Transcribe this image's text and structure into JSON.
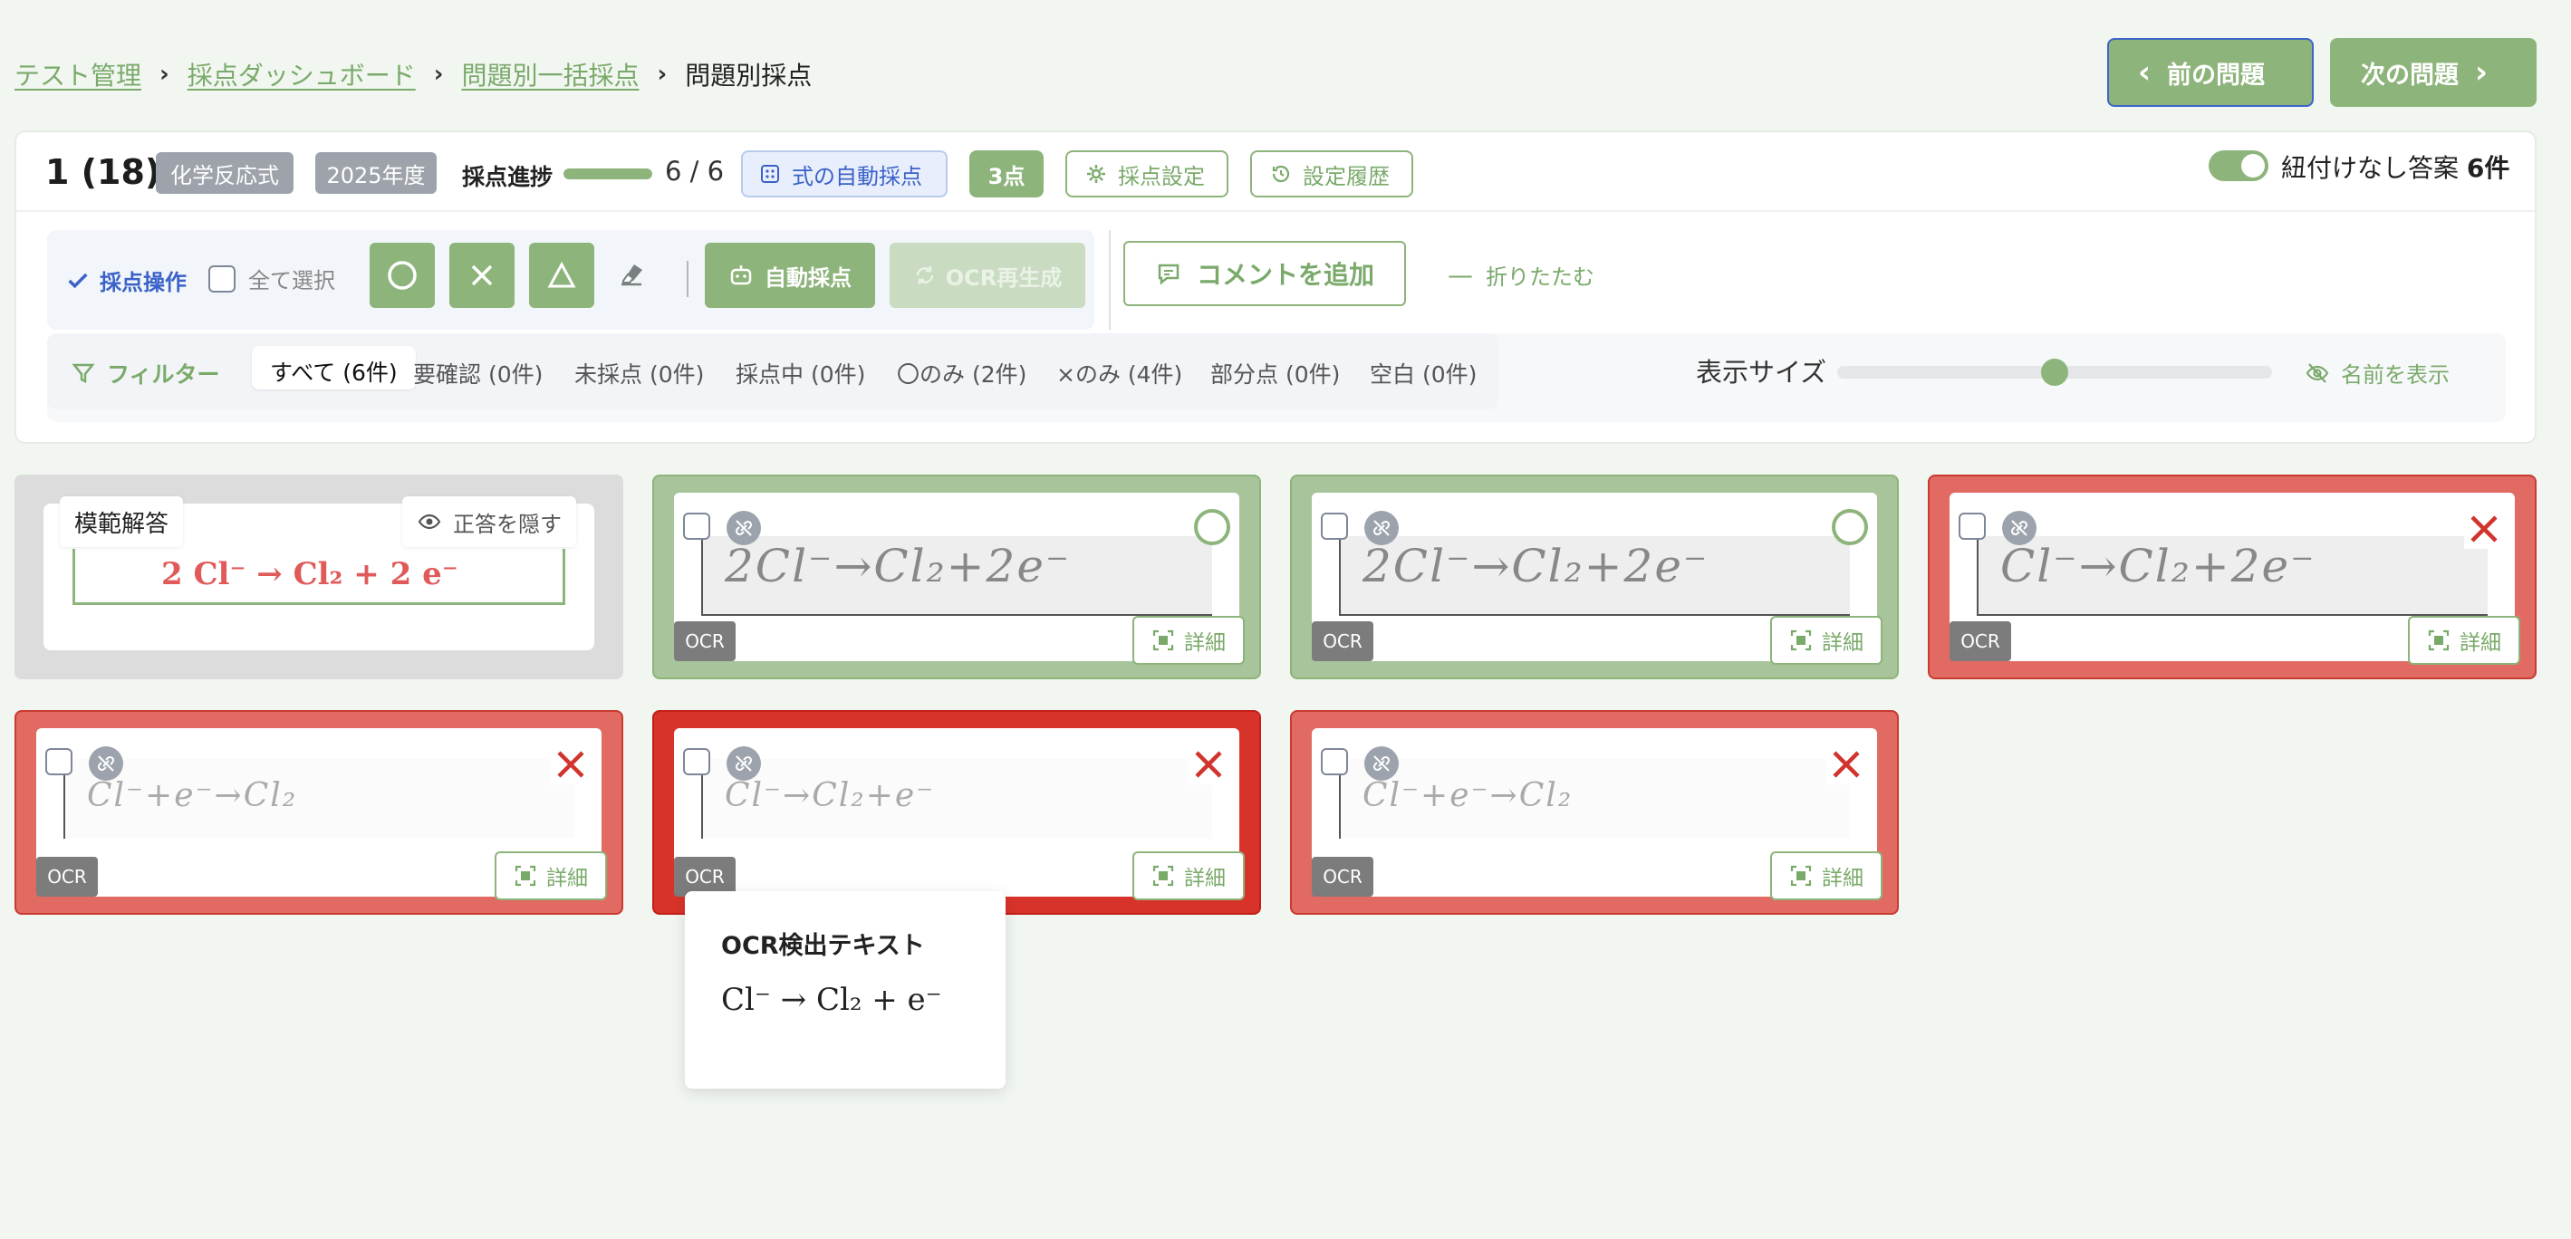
{
  "breadcrumb": {
    "items": [
      "テスト管理",
      "採点ダッシュボード",
      "問題別一括採点"
    ],
    "current": "問題別採点"
  },
  "nav": {
    "prev_label": "前の問題",
    "next_label": "次の問題"
  },
  "question": {
    "number": "1 (18)",
    "tags": [
      "化学反応式",
      "2025年度"
    ],
    "progress_label": "採点進捗",
    "progress_value": 1.0,
    "progress_text": "6 / 6",
    "auto_formula_label": "式の自動採点",
    "points": "3点",
    "settings_label": "採点設定",
    "history_label": "設定履歴",
    "unlinked_label": "紐付けなし答案",
    "unlinked_count": "6件",
    "unlinked_toggle_on": true
  },
  "operations": {
    "label": "採点操作",
    "select_all": "全て選択",
    "auto_grade": "自動採点",
    "ocr_regen": "OCR再生成",
    "add_comment": "コメントを追加",
    "collapse": "折りたたむ"
  },
  "filter": {
    "label": "フィルター",
    "tabs": [
      "すべて (6件)",
      "要確認 (0件)",
      "未採点 (0件)",
      "採点中 (0件)",
      "〇のみ (2件)",
      "×のみ (4件)",
      "部分点 (0件)",
      "空白 (0件)"
    ],
    "active_index": 0,
    "size_label": "表示サイズ",
    "size_value": 0.5,
    "show_name": "名前を表示"
  },
  "model_answer": {
    "label": "模範解答",
    "hide_label": "正答を隠す",
    "formula": "2 Cl⁻ → Cl₂ + 2 e⁻"
  },
  "answers": [
    {
      "handwriting": "2Cl⁻→Cl₂+2e⁻",
      "result": "correct"
    },
    {
      "handwriting": "2Cl⁻→Cl₂+2e⁻",
      "result": "correct"
    },
    {
      "handwriting": "Cl⁻→Cl₂+2e⁻",
      "result": "wrong"
    },
    {
      "handwriting": "Cl⁻+e⁻→Cl₂",
      "result": "wrong"
    },
    {
      "handwriting": "Cl⁻→Cl₂+e⁻",
      "result": "wrong"
    },
    {
      "handwriting": "Cl⁻+e⁻→Cl₂",
      "result": "wrong"
    }
  ],
  "card_labels": {
    "ocr": "OCR",
    "detail": "詳細"
  },
  "ocr_popup": {
    "title": "OCR検出テキスト",
    "formula": "Cl⁻ → Cl₂ + e⁻"
  },
  "colors": {
    "accent": "#8db47a",
    "wrong": "#e16b62",
    "blue": "#3b62c8"
  }
}
